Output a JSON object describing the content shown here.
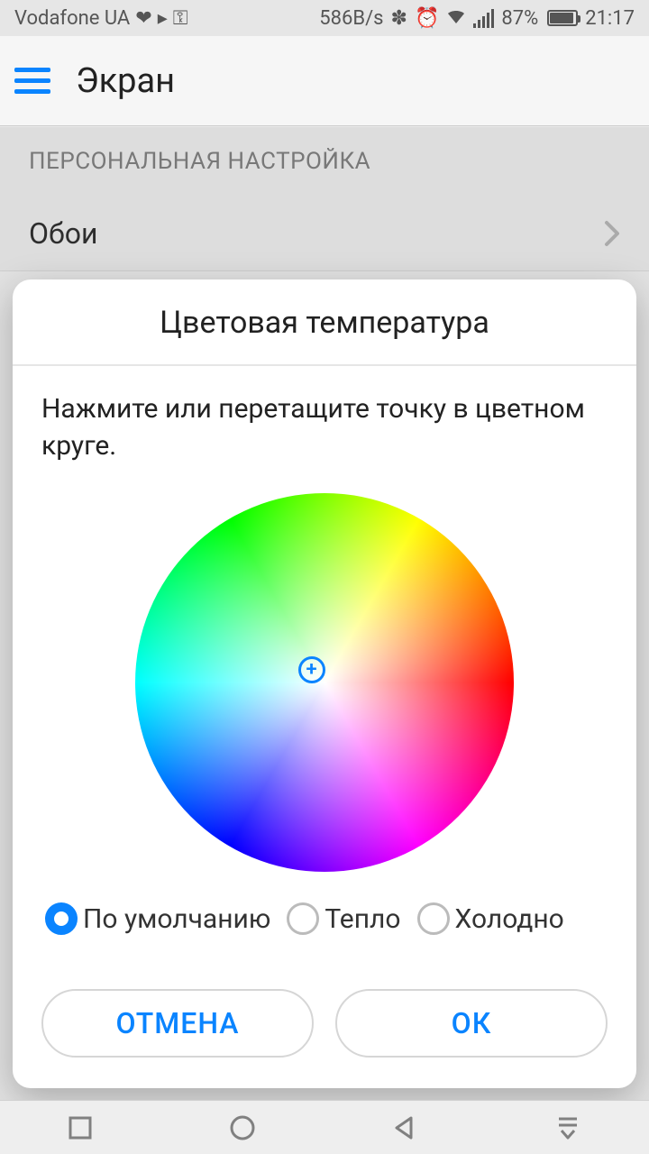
{
  "statusbar": {
    "carrier": "Vodafone UA",
    "data_speed": "586B/s",
    "battery_pct": "87%",
    "time": "21:17"
  },
  "header": {
    "title": "Экран"
  },
  "section_label": "ПЕРСОНАЛЬНАЯ НАСТРОЙКА",
  "list": {
    "wallpaper_label": "Обои"
  },
  "dialog": {
    "title": "Цветовая температура",
    "instruction": "Нажмите или перетащите точку в цветном круге.",
    "options": {
      "default": "По умолчанию",
      "warm": "Тепло",
      "cold": "Холодно"
    },
    "cancel_label": "ОТМЕНА",
    "ok_label": "ОК"
  }
}
